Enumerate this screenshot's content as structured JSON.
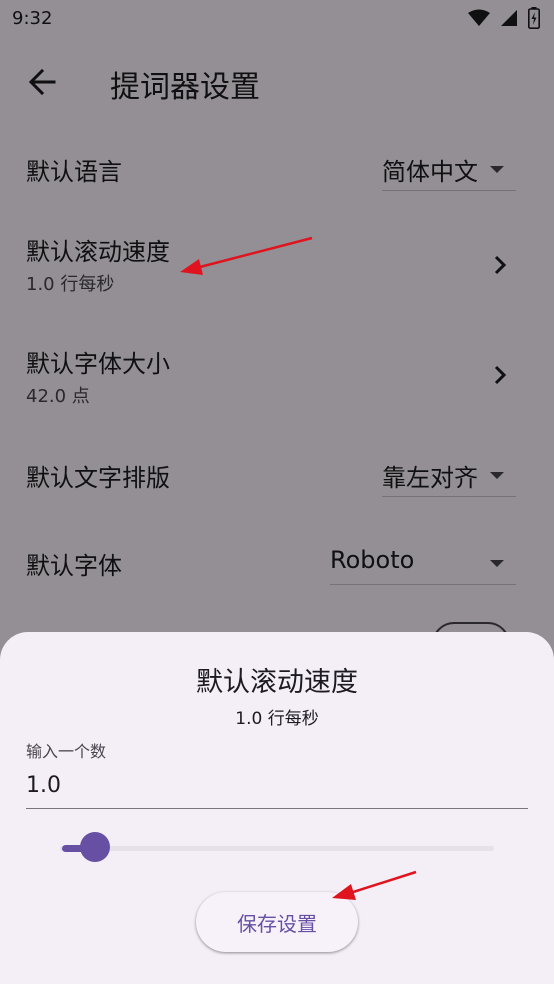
{
  "status_bar": {
    "time": "9:32"
  },
  "app_bar": {
    "title": "提词器设置"
  },
  "settings": {
    "language": {
      "label": "默认语言",
      "value": "简体中文"
    },
    "scroll_speed": {
      "label": "默认滚动速度",
      "value": "1.0 行每秒"
    },
    "font_size": {
      "label": "默认字体大小",
      "value": "42.0 点"
    },
    "text_layout": {
      "label": "默认文字排版",
      "value": "靠左对齐"
    },
    "font": {
      "label": "默认字体",
      "value": "Roboto"
    }
  },
  "sheet": {
    "title": "默认滚动速度",
    "subtitle": "1.0 行每秒",
    "input_label": "输入一个数",
    "input_value": "1.0",
    "slider_level": 0.05,
    "save_label": "保存设置"
  },
  "colors": {
    "accent": "#6750a4",
    "annotation_arrow": "#e0141e"
  }
}
